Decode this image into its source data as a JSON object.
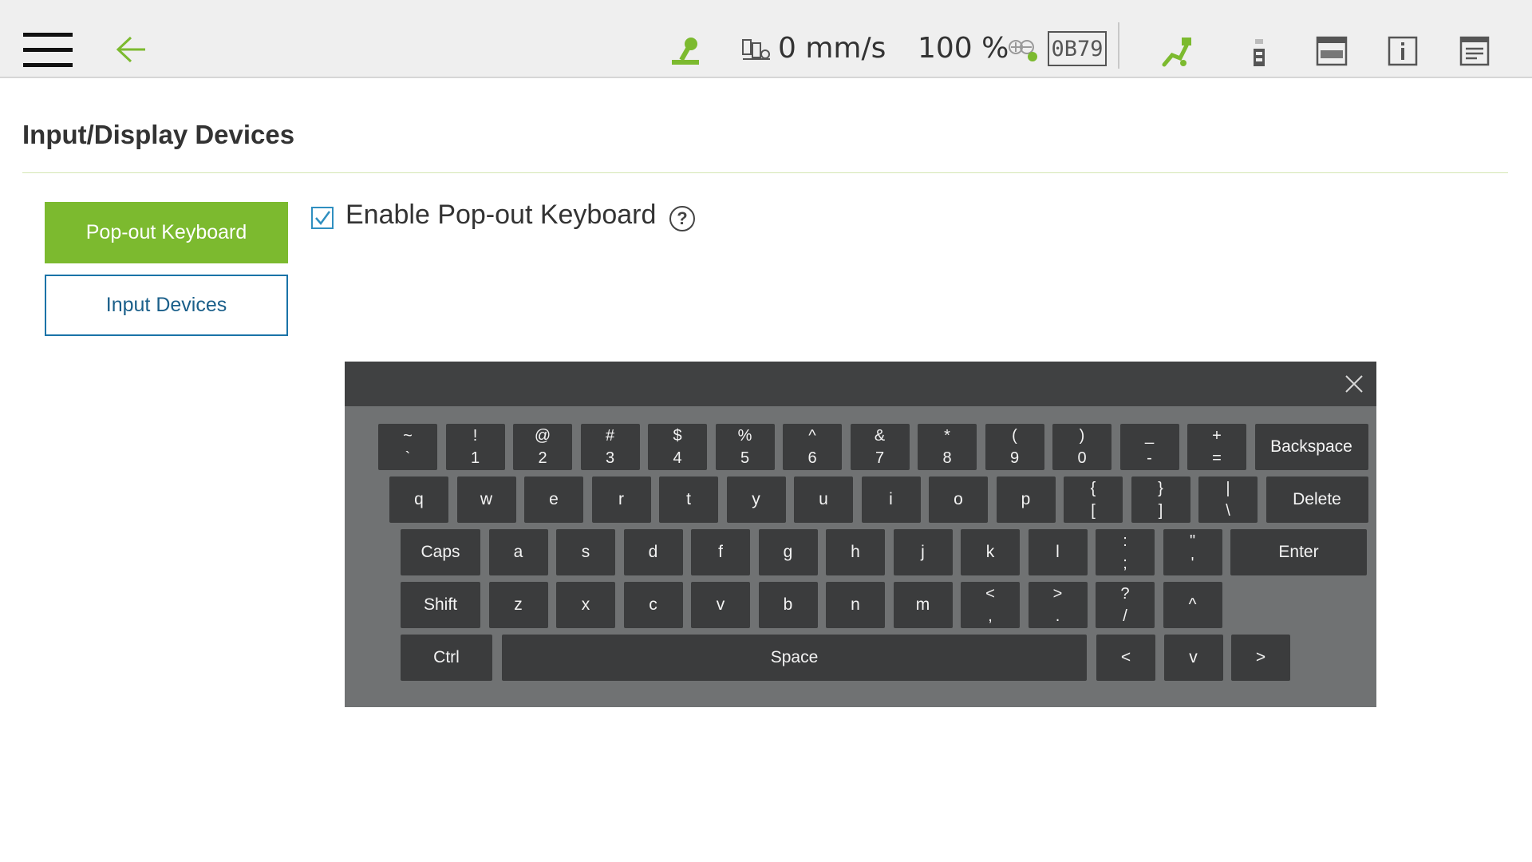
{
  "header": {
    "speed": "0 mm/s",
    "override": "100 %",
    "tool_id": "0B79"
  },
  "page": {
    "title": "Input/Display Devices"
  },
  "nav": {
    "items": [
      {
        "label": "Pop-out Keyboard",
        "active": true
      },
      {
        "label": "Input Devices",
        "active": false
      }
    ]
  },
  "settings": {
    "enable_label": "Enable Pop-out Keyboard",
    "enabled": true,
    "help_glyph": "?"
  },
  "keyboard": {
    "rows": [
      [
        {
          "top": "~",
          "bottom": "`"
        },
        {
          "top": "!",
          "bottom": "1"
        },
        {
          "top": "@",
          "bottom": "2"
        },
        {
          "top": "#",
          "bottom": "3"
        },
        {
          "top": "$",
          "bottom": "4"
        },
        {
          "top": "%",
          "bottom": "5"
        },
        {
          "top": "^",
          "bottom": "6"
        },
        {
          "top": "&",
          "bottom": "7"
        },
        {
          "top": "*",
          "bottom": "8"
        },
        {
          "top": "(",
          "bottom": "9"
        },
        {
          "top": ")",
          "bottom": "0"
        },
        {
          "top": "_",
          "bottom": "-"
        },
        {
          "top": "+",
          "bottom": "="
        },
        {
          "label": "Backspace"
        }
      ],
      [
        {
          "label": "q"
        },
        {
          "label": "w"
        },
        {
          "label": "e"
        },
        {
          "label": "r"
        },
        {
          "label": "t"
        },
        {
          "label": "y"
        },
        {
          "label": "u"
        },
        {
          "label": "i"
        },
        {
          "label": "o"
        },
        {
          "label": "p"
        },
        {
          "top": "{",
          "bottom": "["
        },
        {
          "top": "}",
          "bottom": "]"
        },
        {
          "top": "|",
          "bottom": "\\"
        },
        {
          "label": "Delete"
        }
      ],
      [
        {
          "label": "Caps"
        },
        {
          "label": "a"
        },
        {
          "label": "s"
        },
        {
          "label": "d"
        },
        {
          "label": "f"
        },
        {
          "label": "g"
        },
        {
          "label": "h"
        },
        {
          "label": "j"
        },
        {
          "label": "k"
        },
        {
          "label": "l"
        },
        {
          "top": ":",
          "bottom": ";"
        },
        {
          "top": "\"",
          "bottom": "'"
        },
        {
          "label": "Enter"
        }
      ],
      [
        {
          "label": "Shift"
        },
        {
          "label": "z"
        },
        {
          "label": "x"
        },
        {
          "label": "c"
        },
        {
          "label": "v"
        },
        {
          "label": "b"
        },
        {
          "label": "n"
        },
        {
          "label": "m"
        },
        {
          "top": "<",
          "bottom": ","
        },
        {
          "top": ">",
          "bottom": "."
        },
        {
          "top": "?",
          "bottom": "/"
        },
        {
          "label": "^"
        }
      ],
      [
        {
          "label": "Ctrl"
        },
        {
          "label": "Space"
        },
        {
          "label": "<"
        },
        {
          "label": "v"
        },
        {
          "label": ">"
        }
      ]
    ]
  },
  "colors": {
    "accent_green": "#7cba2f",
    "link_blue": "#1a73a8",
    "keyboard_bg": "#707273",
    "key_bg": "#3b3c3d"
  }
}
